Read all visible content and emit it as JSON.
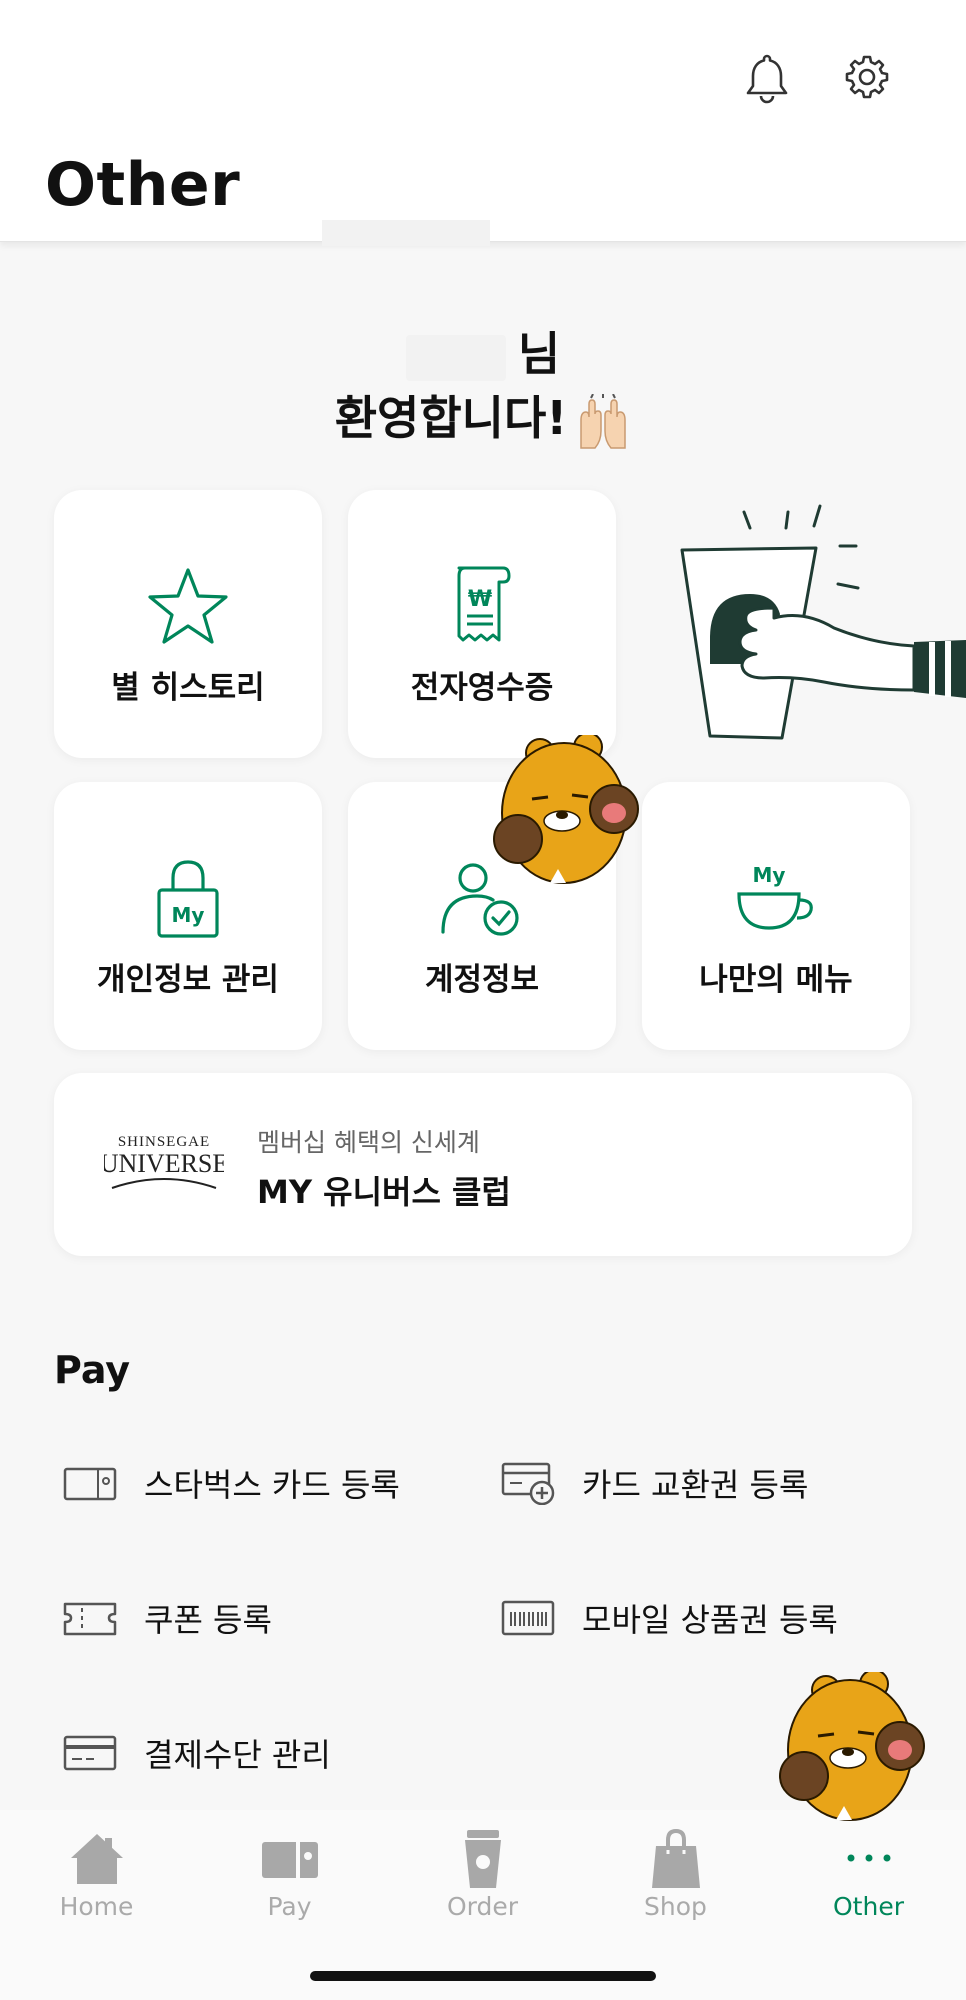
{
  "header": {
    "title": "Other"
  },
  "welcome": {
    "line1": "님",
    "line2": "환영합니다!"
  },
  "tiles": [
    {
      "label": "별 히스토리",
      "icon": "star-icon"
    },
    {
      "label": "전자영수증",
      "icon": "receipt-icon"
    },
    {
      "label": "개인정보 관리",
      "icon": "lock-my-icon"
    },
    {
      "label": "계정정보",
      "icon": "account-check-icon"
    },
    {
      "label": "나만의 메뉴",
      "icon": "my-cup-icon"
    }
  ],
  "universe": {
    "logo_top": "SHINSEGAE",
    "logo_bottom": "UNIVERSE",
    "subtitle": "멤버십 혜택의 신세계",
    "title": "MY 유니버스 클럽"
  },
  "pay": {
    "heading": "Pay",
    "items": [
      {
        "label": "스타벅스 카드 등록",
        "icon": "card-icon"
      },
      {
        "label": "카드 교환권 등록",
        "icon": "card-plus-icon"
      },
      {
        "label": "쿠폰 등록",
        "icon": "coupon-icon"
      },
      {
        "label": "모바일 상품권 등록",
        "icon": "barcode-icon"
      },
      {
        "label": "결제수단 관리",
        "icon": "credit-card-icon"
      }
    ]
  },
  "tabbar": {
    "items": [
      {
        "label": "Home",
        "icon": "home-icon"
      },
      {
        "label": "Pay",
        "icon": "wallet-icon"
      },
      {
        "label": "Order",
        "icon": "cup-icon"
      },
      {
        "label": "Shop",
        "icon": "bag-icon"
      },
      {
        "label": "Other",
        "icon": "more-dots-icon",
        "active": true
      }
    ]
  },
  "colors": {
    "accent": "#00865a",
    "tab_inactive": "#aaaaaa",
    "ryan": "#e8a418"
  }
}
